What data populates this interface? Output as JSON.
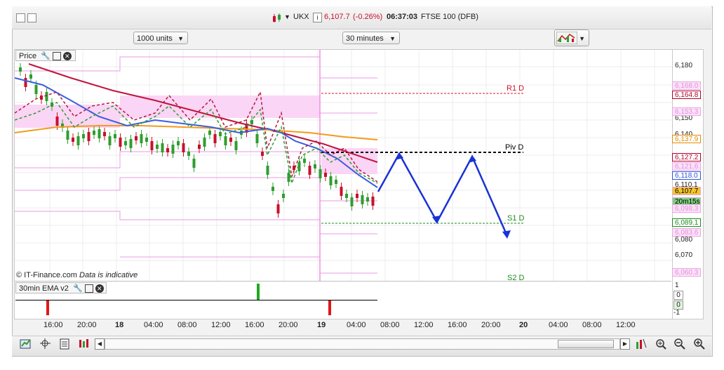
{
  "titlebar": {
    "instrument": "UKX",
    "info_icon": "i",
    "price": "6,107.7",
    "change": "(-0.26%)",
    "time": "06:37:03",
    "name": "FTSE 100 (DFB)"
  },
  "toolbar": {
    "units_value": "1000 units",
    "interval_value": "30 minutes"
  },
  "price_panel": {
    "title": "Price",
    "copyright": "© IT-Finance.com",
    "indicative": "Data is indicative"
  },
  "ema_panel": {
    "title": "30min EMA v2",
    "axis_labels": [
      "1",
      "0",
      "0",
      "-1"
    ]
  },
  "pivot_labels": [
    "R1 D",
    "Piv D",
    "S1 D",
    "S2 D"
  ],
  "y_axis": {
    "ticks": [
      "6,180",
      "6,150",
      "6,140",
      "6,110.1",
      "6,080",
      "6,070"
    ],
    "price_labels": [
      {
        "text": "6,168.0",
        "color": "#e78be0",
        "bg": "#fbe3f8"
      },
      {
        "text": "6,164.8",
        "color": "#b3002a",
        "bg": "#ffffff"
      },
      {
        "text": "6,153.3",
        "color": "#e78be0",
        "bg": "#fbe3f8"
      },
      {
        "text": "6,137.9",
        "color": "#e58a00",
        "bg": "#ffffff"
      },
      {
        "text": "6,127.2",
        "color": "#b3002a",
        "bg": "#ffffff"
      },
      {
        "text": "6,121.6",
        "color": "#e78be0",
        "bg": "#fbe3f8"
      },
      {
        "text": "6,118.0",
        "color": "#2b55d6",
        "bg": "#ffffff"
      },
      {
        "text": "6,107.7",
        "color": "#000000",
        "bg": "#f4c430"
      },
      {
        "text": "20m15s",
        "color": "#000000",
        "bg": "#7fd17f"
      },
      {
        "text": "6,098.3",
        "color": "#e78be0",
        "bg": "#fbe3f8"
      },
      {
        "text": "6,089.1",
        "color": "#1c8a1c",
        "bg": "#ffffff"
      },
      {
        "text": "6,083.6",
        "color": "#e78be0",
        "bg": "#fbe3f8"
      },
      {
        "text": "6,060.3",
        "color": "#e78be0",
        "bg": "#fbe3f8"
      }
    ]
  },
  "x_axis": {
    "labels": [
      "16:00",
      "20:00",
      "18",
      "04:00",
      "08:00",
      "12:00",
      "16:00",
      "20:00",
      "19",
      "04:00",
      "08:00",
      "12:00",
      "16:00",
      "20:00",
      "20",
      "04:00",
      "08:00",
      "12:00"
    ]
  },
  "colors": {
    "bull_candle": "#2e9e2e",
    "bear_candle": "#c8102e",
    "ema_fast": "#3a5ee0",
    "ema_slow": "#c0143c",
    "sma_orange": "#f39a1e",
    "band_pink": "#f7b7ee",
    "projection": "#1a32d6",
    "pivot_black": "#000000",
    "r1_red": "#d0142e",
    "s1_green": "#1c8a1c"
  },
  "icons": {
    "window_buttons": [
      "close-icon",
      "restore-icon"
    ],
    "instrument": "candlestick-icon",
    "chart_type": "chart-type-icon",
    "bottom_tools": [
      "trade-ticket-icon",
      "crosshair-icon",
      "print-icon",
      "indicator-icon",
      "scroll-left-icon",
      "scroll-right-icon",
      "draw-tools-icon",
      "zoom-fit-icon",
      "zoom-out-icon",
      "zoom-in-icon"
    ]
  }
}
